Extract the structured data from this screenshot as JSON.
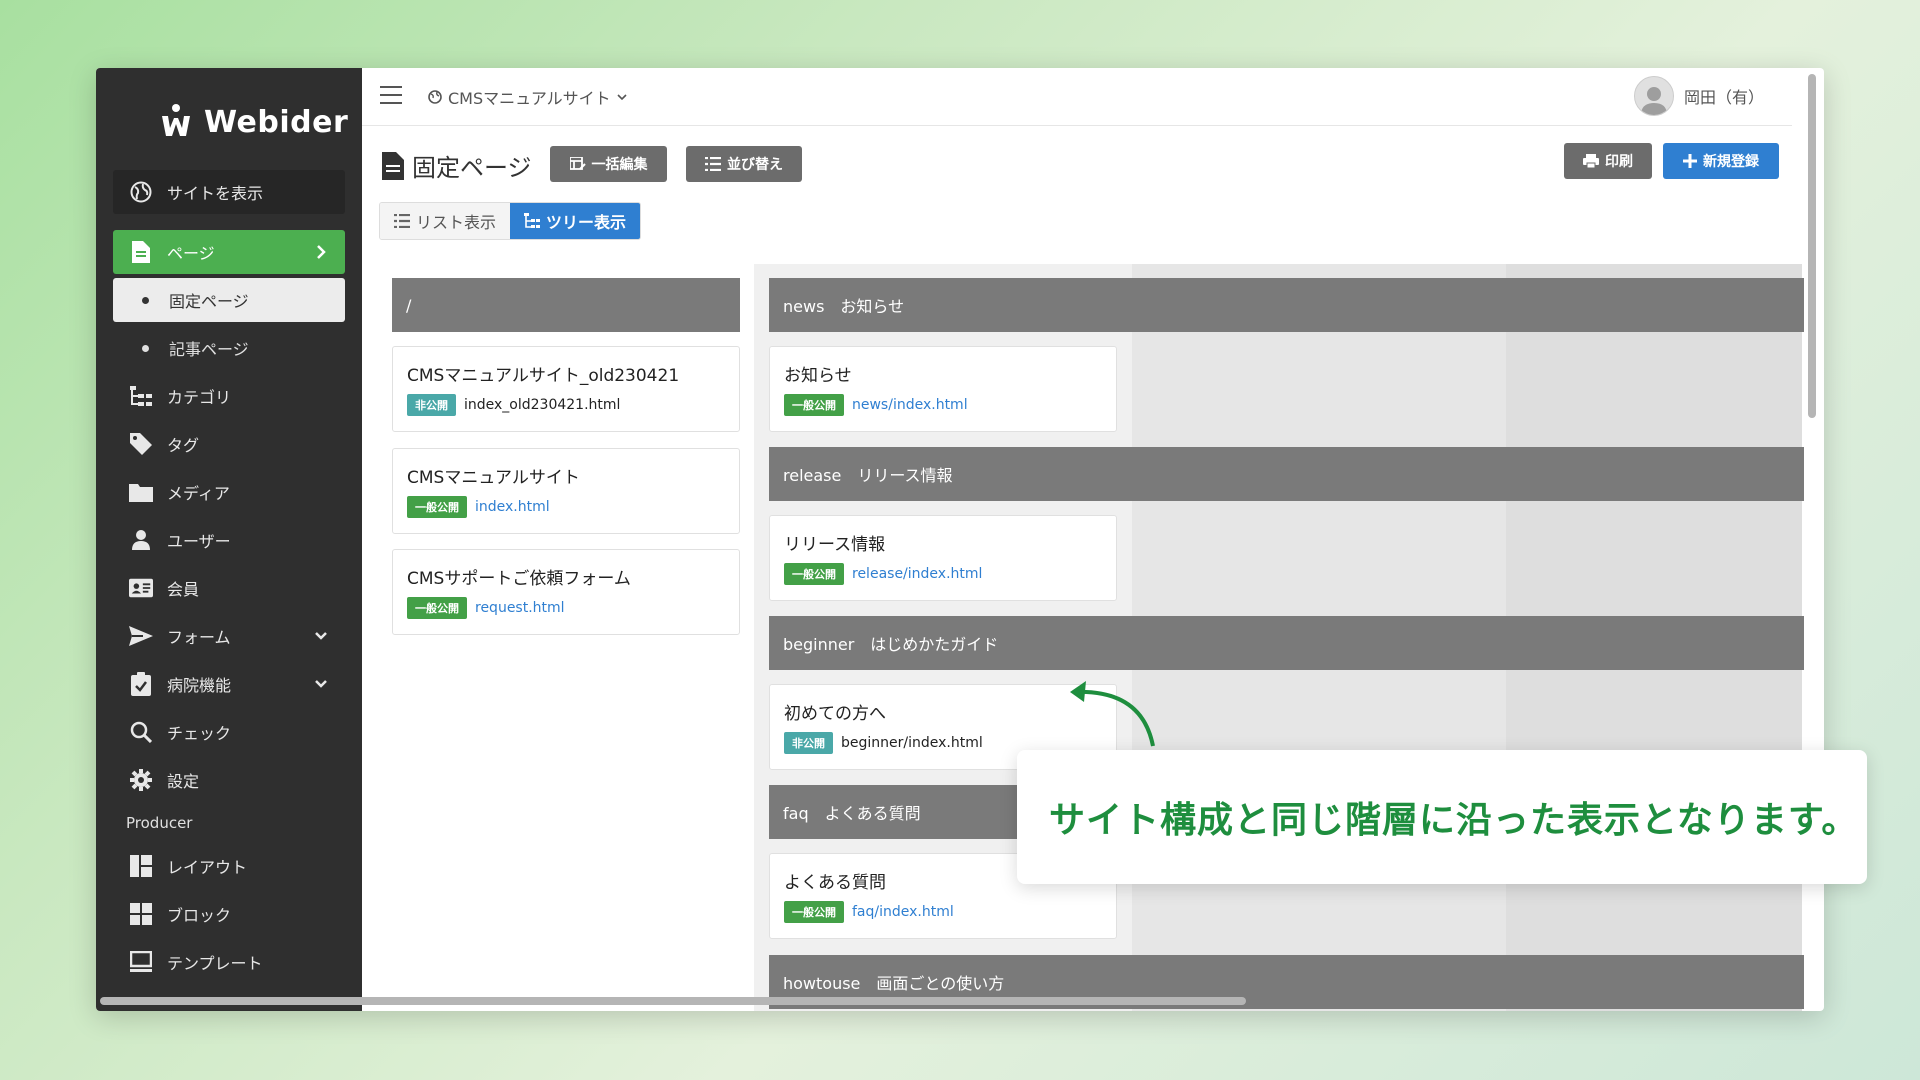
{
  "app": {
    "logo": "Webider"
  },
  "topbar": {
    "site_name": "CMSマニュアルサイト",
    "user_name": "岡田（有）"
  },
  "sidebar": {
    "view_site": "サイトを表示",
    "items": [
      {
        "label": "ページ"
      },
      {
        "label": "固定ページ"
      },
      {
        "label": "記事ページ"
      },
      {
        "label": "カテゴリ"
      },
      {
        "label": "タグ"
      },
      {
        "label": "メディア"
      },
      {
        "label": "ユーザー"
      },
      {
        "label": "会員"
      },
      {
        "label": "フォーム"
      },
      {
        "label": "病院機能"
      },
      {
        "label": "チェック"
      },
      {
        "label": "設定"
      }
    ],
    "section_heading": "Producer",
    "producer_items": [
      {
        "label": "レイアウト"
      },
      {
        "label": "ブロック"
      },
      {
        "label": "テンプレート"
      }
    ]
  },
  "page": {
    "title": "固定ページ",
    "bulk_edit": "一括編集",
    "sort": "並び替え",
    "print": "印刷",
    "new": "新規登録",
    "view_list": "リスト表示",
    "view_tree": "ツリー表示"
  },
  "tree": {
    "root": {
      "label": "/",
      "pages": [
        {
          "title": "CMSマニュアルサイト_old230421",
          "status": "非公開",
          "file": "index_old230421.html"
        },
        {
          "title": "CMSマニュアルサイト",
          "status": "一般公開",
          "file": "index.html"
        },
        {
          "title": "CMSサポートご依頼フォーム",
          "status": "一般公開",
          "file": "request.html"
        }
      ]
    },
    "folders": [
      {
        "label": "news　お知らせ",
        "page": {
          "title": "お知らせ",
          "status": "一般公開",
          "file": "news/index.html"
        }
      },
      {
        "label": "release　リリース情報",
        "page": {
          "title": "リリース情報",
          "status": "一般公開",
          "file": "release/index.html"
        }
      },
      {
        "label": "beginner　はじめかたガイド",
        "page": {
          "title": "初めての方へ",
          "status": "非公開",
          "file": "beginner/index.html"
        }
      },
      {
        "label": "faq　よくある質問",
        "page": {
          "title": "よくある質問",
          "status": "一般公開",
          "file": "faq/index.html"
        }
      },
      {
        "label": "howtouse　画面ごとの使い方"
      }
    ]
  },
  "callout": {
    "text": "サイト構成と同じ階層に沿った表示となります。"
  },
  "colors": {
    "accent_green": "#4caf50",
    "accent_blue": "#2f7fd1",
    "callout_green": "#1e8e3e",
    "sidebar_bg": "#2f2f2f"
  }
}
